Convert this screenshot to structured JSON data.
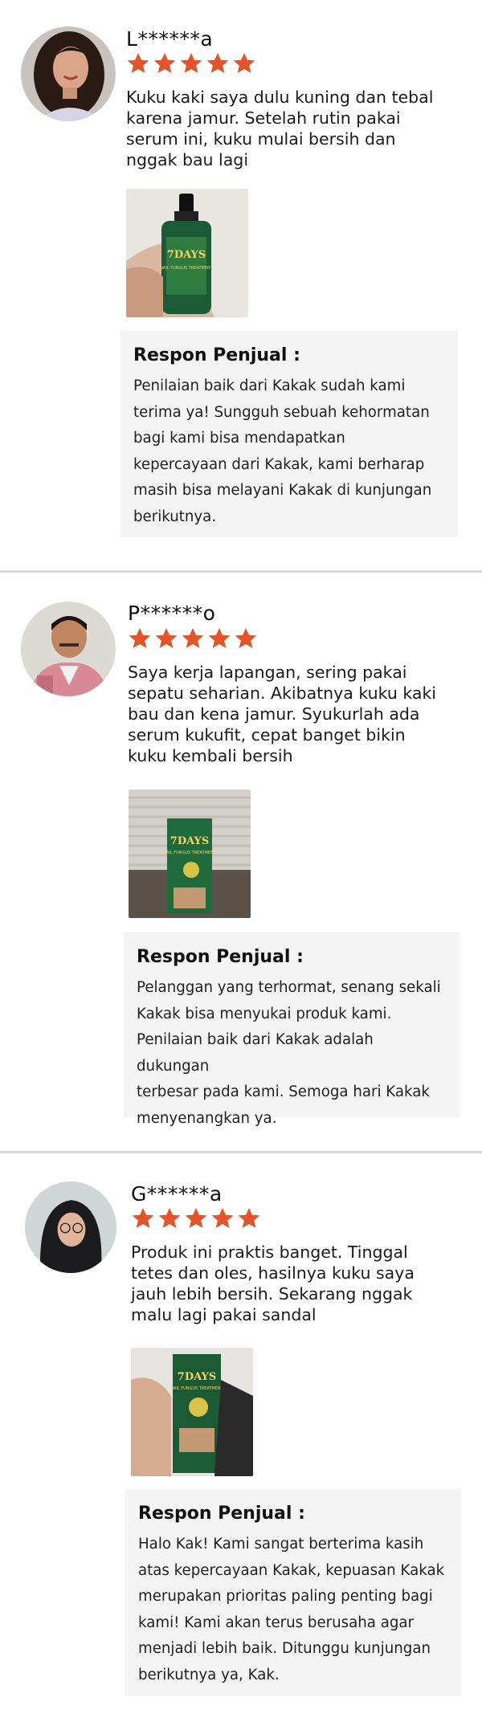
{
  "reviews": [
    {
      "reviewer_name": "L******a",
      "rating": 5,
      "text": "Kuku kaki saya dulu kuning dan tebal\nkarena jamur. Setelah rutin pakai\nserum ini, kuku mulai bersih dan\nnggak bau lagi",
      "reply_title": "Respon Penjual :",
      "reply_text": "Penilaian baik dari Kakak sudah kami\nterima ya! Sungguh sebuah kehormatan\nbagi kami bisa mendapatkan\nkepercayaan dari Kakak, kami berharap\nmasih bisa melayani Kakak di kunjungan\nberikutnya."
    },
    {
      "reviewer_name": "P******o",
      "rating": 5,
      "text": "Saya kerja lapangan, sering pakai\nsepatu seharian. Akibatnya kuku kaki\nbau dan kena jamur. Syukurlah ada\nserum kukufit, cepat banget bikin\nkuku kembali bersih",
      "reply_title": "Respon Penjual :",
      "reply_text": "Pelanggan yang terhormat, senang sekali\nKakak bisa menyukai produk kami.\nPenilaian baik dari Kakak adalah dukungan\nterbesar pada kami. Semoga hari Kakak\nmenyenangkan ya."
    },
    {
      "reviewer_name": "G******a",
      "rating": 5,
      "text": "Produk ini praktis banget. Tinggal\ntetes dan oles, hasilnya kuku saya\njauh lebih bersih. Sekarang nggak\nmalu lagi pakai sandal",
      "reply_title": "Respon Penjual :",
      "reply_text": "Halo Kak! Kami sangat berterima kasih\natas kepercayaan Kakak, kepuasan Kakak\nmerupakan prioritas paling penting bagi\nkami! Kami akan terus berusaha agar\nmenjadi lebih baik. Ditunggu kunjungan\nberikutnya ya, Kak."
    }
  ],
  "product_label": {
    "brand_line": "7DAYS",
    "sub_line": "NAIL FUNGUS TREATMENT"
  },
  "colors": {
    "star": "#e4532a",
    "reply_bg": "#f4f4f4",
    "divider": "#d9d9d9"
  },
  "icons": {
    "star": "star-icon"
  }
}
